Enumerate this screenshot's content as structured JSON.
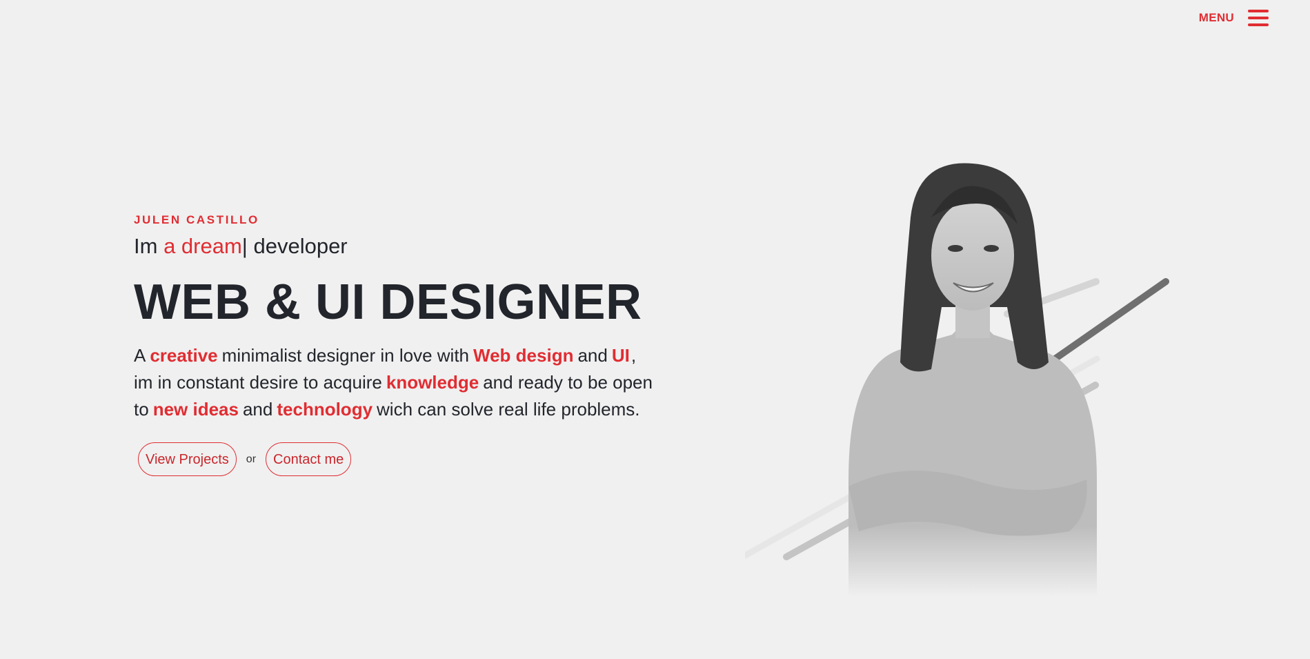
{
  "header": {
    "menu_label": "MENU"
  },
  "hero": {
    "name": "JULEN CASTILLO",
    "role_prefix": "Im ",
    "role_typed": "a dream",
    "role_cursor": "|",
    "role_suffix": " developer",
    "headline": "WEB & UI DESIGNER",
    "description": {
      "part1": "A",
      "hl1": "creative",
      "part2": "minimalist designer in love with",
      "hl2": "Web design",
      "part3": "and",
      "hl3": "UI",
      "part4": ",",
      "part5": "im in constant desire to acquire",
      "hl4": "knowledge",
      "part6": "and ready to be open",
      "part7": "to",
      "hl5": "new ideas",
      "part8": "and",
      "hl6": "technology",
      "part9": "wich can solve real life problems."
    },
    "buttons": {
      "projects": "View Projects",
      "or": "or",
      "contact": "Contact me"
    }
  },
  "colors": {
    "accent": "#e02d32",
    "text": "#22252b",
    "background": "#f0f0f0"
  },
  "icons": {
    "menu": "hamburger-icon"
  }
}
